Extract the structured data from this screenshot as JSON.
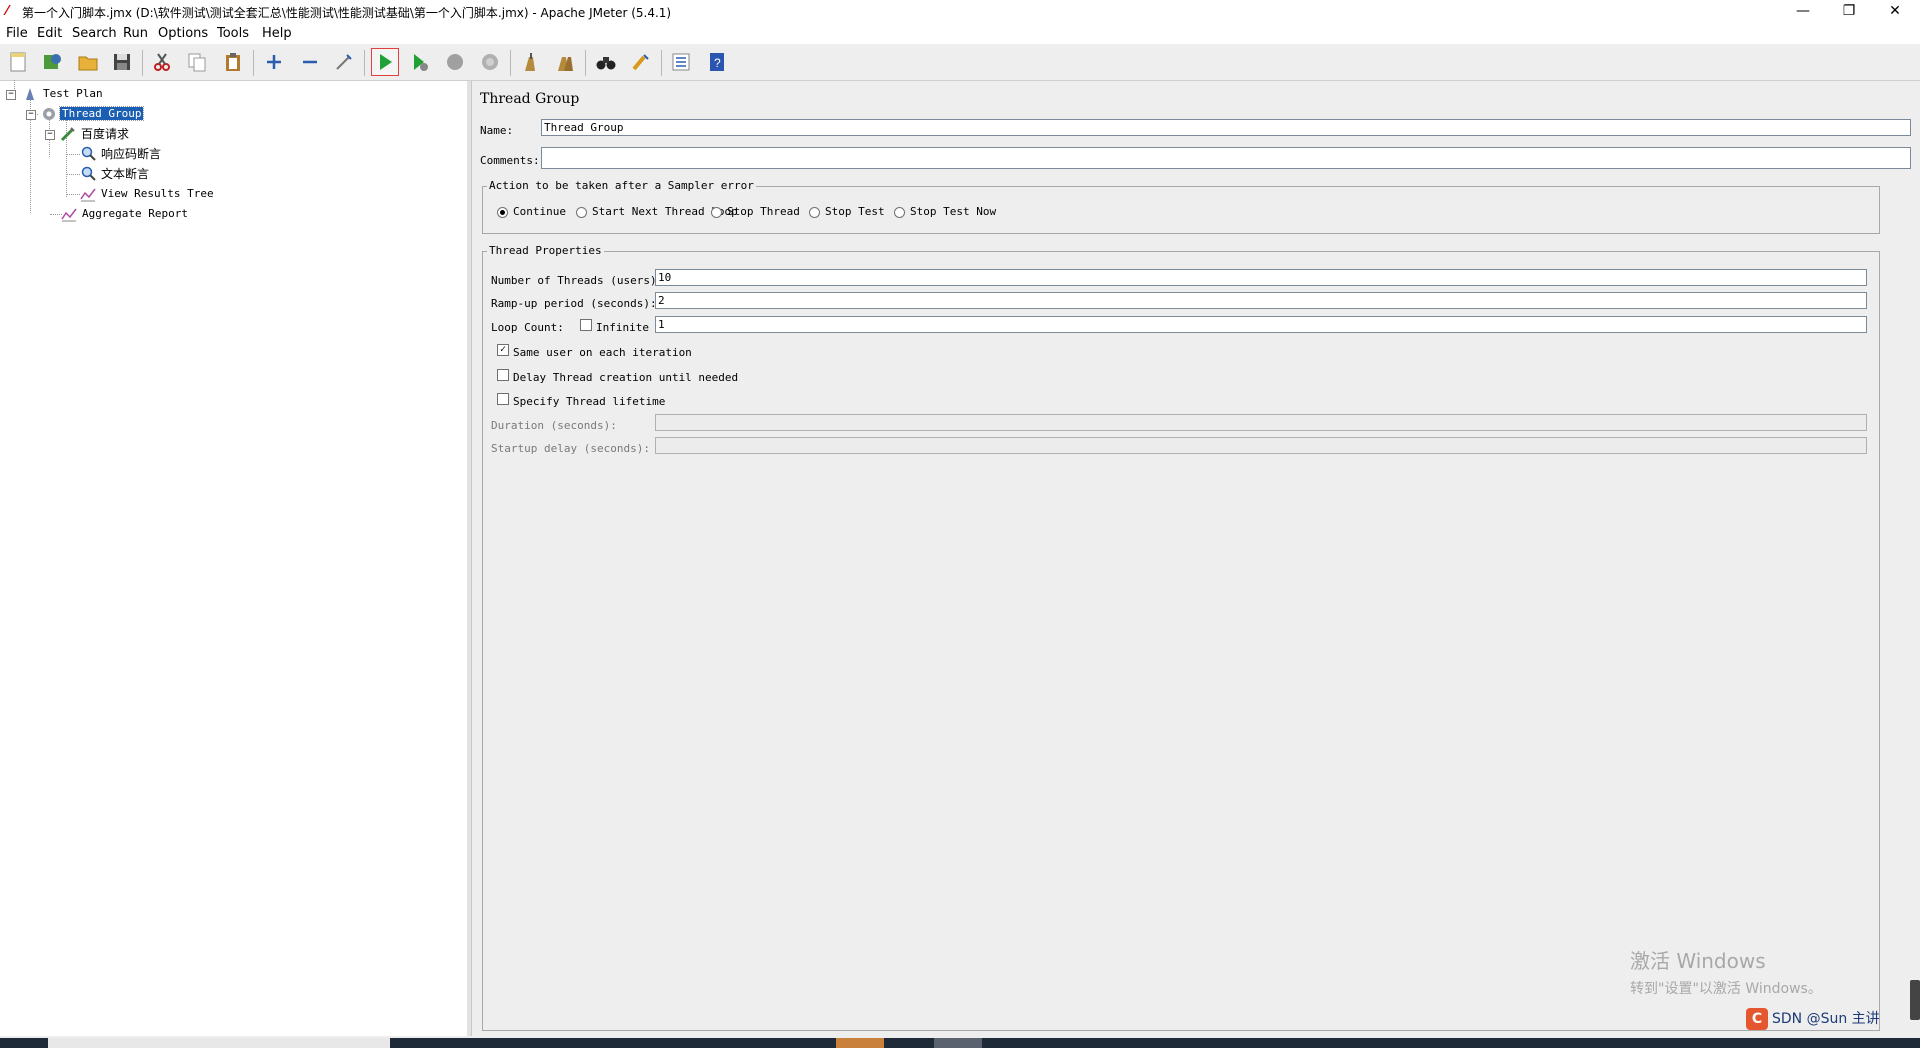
{
  "window": {
    "title": "第一个入门脚本.jmx (D:\\软件测试\\测试全套汇总\\性能测试\\性能测试基础\\第一个入门脚本.jmx) - Apache JMeter (5.4.1)",
    "icon": "jmeter-feather-icon",
    "controls": {
      "minimize": "—",
      "restore": "❐",
      "close": "✕"
    }
  },
  "menu": [
    "File",
    "Edit",
    "Search",
    "Run",
    "Options",
    "Tools",
    "Help"
  ],
  "toolbar": {
    "buttons": [
      "new",
      "templates",
      "open",
      "save",
      "cut",
      "copy",
      "paste",
      "expand-all",
      "collapse-all",
      "toggle",
      "start",
      "start-no-pauses",
      "stop",
      "shutdown",
      "clear",
      "clear-all",
      "search",
      "reset-search",
      "function-helper",
      "help"
    ],
    "highlighted": "start"
  },
  "tree": {
    "nodes": [
      {
        "label": "Test Plan",
        "icon": "test-plan-icon"
      },
      {
        "label": "Thread Group",
        "icon": "thread-group-gear-icon",
        "selected": true
      },
      {
        "label": "百度请求",
        "icon": "http-sampler-pipette-icon"
      },
      {
        "label": "响应码断言",
        "icon": "assertion-magnifier-icon"
      },
      {
        "label": "文本断言",
        "icon": "assertion-magnifier-icon"
      },
      {
        "label": "View Results Tree",
        "icon": "listener-graph-icon"
      },
      {
        "label": "Aggregate Report",
        "icon": "listener-graph-icon"
      }
    ]
  },
  "panel": {
    "title": "Thread Group",
    "name_label": "Name:",
    "name_value": "Thread Group",
    "comments_label": "Comments:",
    "comments_value": "",
    "sampler_error": {
      "legend": "Action to be taken after a Sampler error",
      "options": [
        "Continue",
        "Start Next Thread Loop",
        "Stop Thread",
        "Stop Test",
        "Stop Test Now"
      ],
      "selected": "Continue"
    },
    "thread_props": {
      "legend": "Thread Properties",
      "threads_label": "Number of Threads (users):",
      "threads_value": "10",
      "rampup_label": "Ramp-up period (seconds):",
      "rampup_value": "2",
      "loop_label": "Loop Count:",
      "infinite_label": "Infinite",
      "infinite_checked": false,
      "loop_value": "1",
      "same_user_label": "Same user on each iteration",
      "same_user_checked": true,
      "delay_label": "Delay Thread creation until needed",
      "delay_checked": false,
      "lifetime_label": "Specify Thread lifetime",
      "lifetime_checked": false,
      "duration_label": "Duration (seconds):",
      "duration_value": "",
      "startup_label": "Startup delay (seconds):",
      "startup_value": ""
    }
  },
  "watermark": {
    "line1": "激活 Windows",
    "line2": "转到\"设置\"以激活 Windows。"
  },
  "csdn_text": "SDN @Sun 主讲"
}
